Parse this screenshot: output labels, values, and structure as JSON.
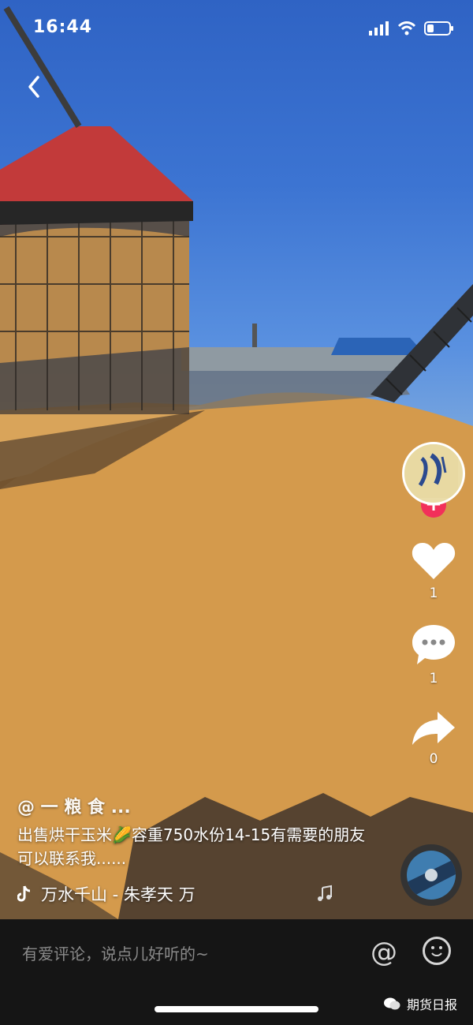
{
  "status_bar": {
    "time": "16:44"
  },
  "caption": {
    "handle": "@ 一 粮 食 ...",
    "description": "出售烘干玉米🌽容重750水份14-15有需要的朋友可以联系我......"
  },
  "music": {
    "text": "万水千山 - 朱孝天 万"
  },
  "actions": {
    "likes": "1",
    "comments": "1",
    "shares": "0",
    "follow_symbol": "+"
  },
  "bottom_bar": {
    "comment_placeholder": "有爱评论，说点儿好听的~",
    "at_symbol": "@",
    "brand": "期货日报"
  },
  "icons": [
    "back-icon",
    "signal-icon",
    "wifi-icon",
    "battery-icon",
    "heart-icon",
    "comment-icon",
    "share-icon",
    "music-note-icon",
    "tiktok-logo-icon",
    "emoji-icon",
    "wechat-icon"
  ],
  "colors": {
    "accent_pink": "#f2305a",
    "bottom_bar_bg": "#151515"
  }
}
